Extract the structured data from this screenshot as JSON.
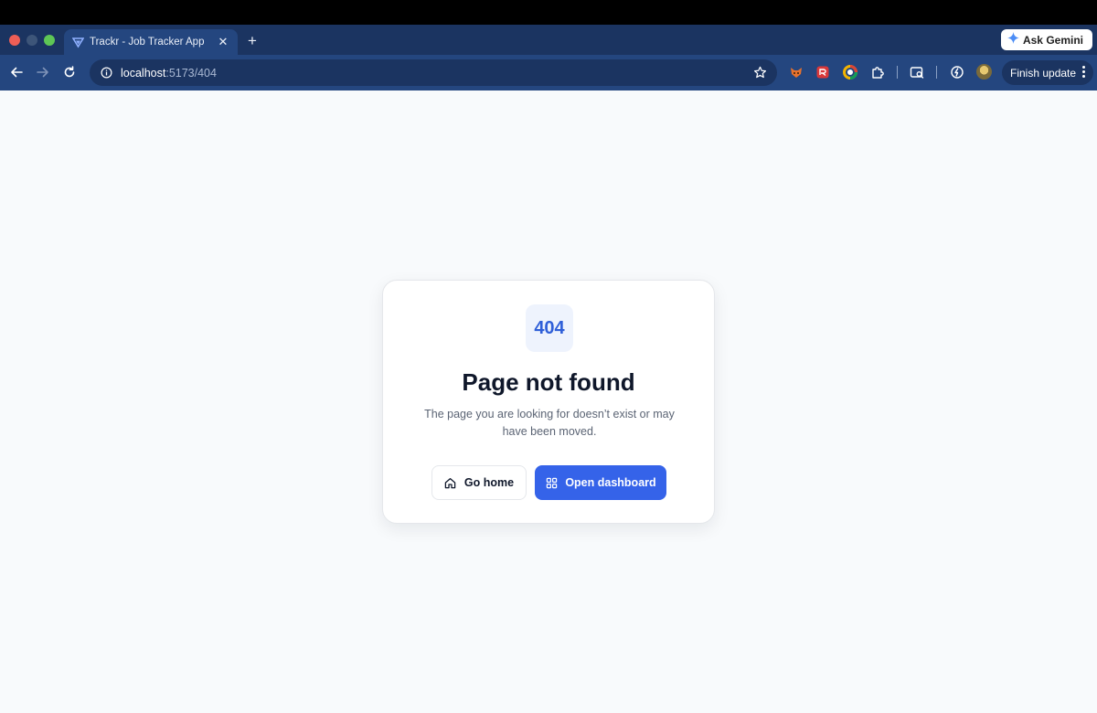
{
  "browser": {
    "tab": {
      "title": "Trackr - Job Tracker App",
      "close_glyph": "✕",
      "favicon": "trackr-logo-icon"
    },
    "new_tab_glyph": "+",
    "ask_gemini_label": "Ask Gemini",
    "url_host": "localhost",
    "url_path": ":5173/404",
    "finish_update_label": "Finish update",
    "extensions": [
      "fox-extension-icon",
      "red-extension-icon",
      "color-wheel-extension-icon",
      "puzzle-extensions-icon",
      "tab-search-icon",
      "performance-icon"
    ]
  },
  "page": {
    "code": "404",
    "title": "Page not found",
    "description": "The page you are looking for doesn’t exist or may have been moved.",
    "home_button": "Go home",
    "dashboard_button": "Open dashboard"
  },
  "colors": {
    "accent": "#3563e9",
    "tabbar": "#1b3461",
    "toolbar": "#24467f",
    "page_bg": "#f8fafc"
  }
}
